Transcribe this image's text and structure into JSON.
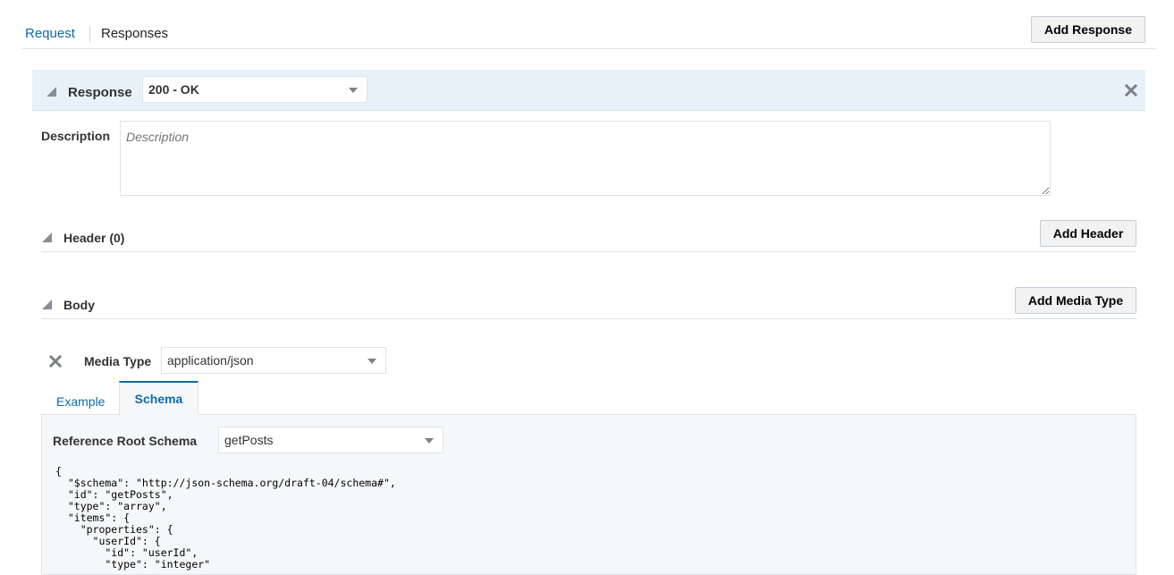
{
  "tabs": {
    "request": "Request",
    "responses": "Responses"
  },
  "toolbar": {
    "add_response": "Add Response"
  },
  "response": {
    "label": "Response",
    "status_value": "200 - OK"
  },
  "description": {
    "label": "Description",
    "placeholder": "Description"
  },
  "header": {
    "title": "Header (0)",
    "add_label": "Add Header"
  },
  "body": {
    "title": "Body",
    "add_media_label": "Add Media Type"
  },
  "media": {
    "label": "Media Type",
    "value": "application/json"
  },
  "subtabs": {
    "example": "Example",
    "schema": "Schema"
  },
  "schema": {
    "ref_label": "Reference Root Schema",
    "ref_value": "getPosts",
    "code": "{\n  \"$schema\": \"http://json-schema.org/draft-04/schema#\",\n  \"id\": \"getPosts\",\n  \"type\": \"array\",\n  \"items\": {\n    \"properties\": {\n      \"userId\": {\n        \"id\": \"userId\",\n        \"type\": \"integer\""
  },
  "colors": {
    "accent": "#0e6aa8",
    "header_band": "#e8f1f8",
    "panel_bg": "#f5f7f9"
  }
}
